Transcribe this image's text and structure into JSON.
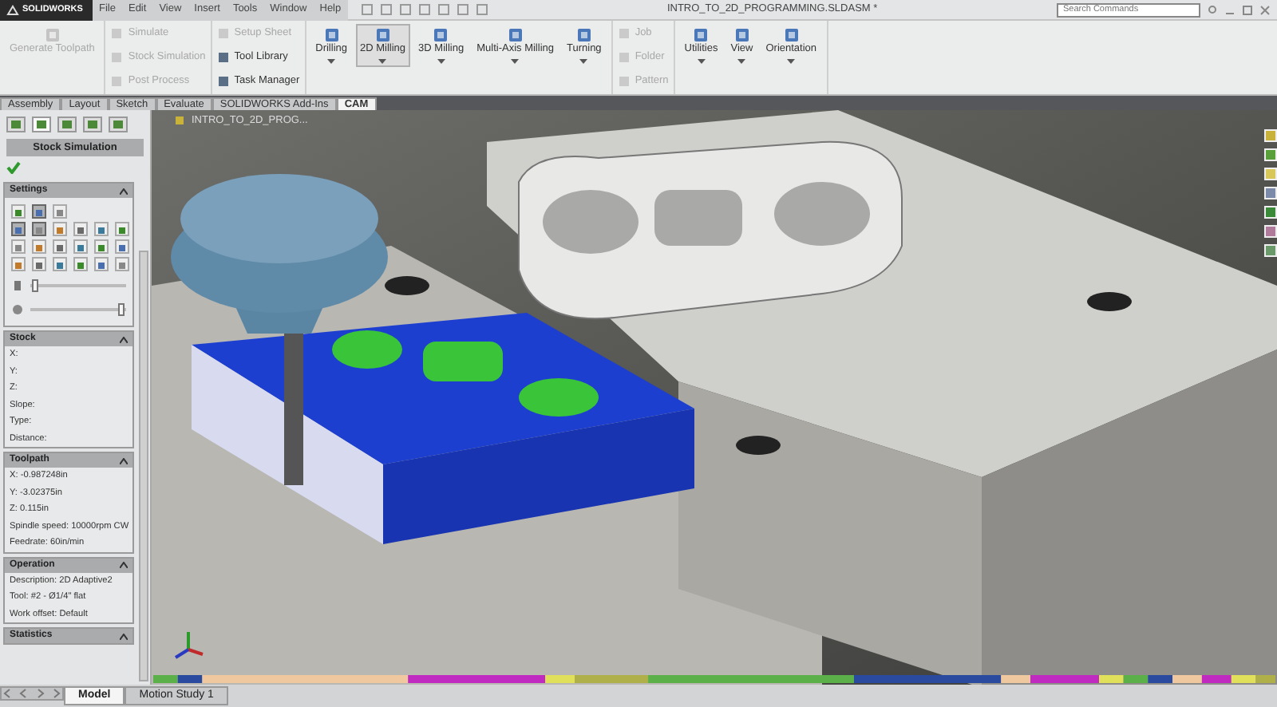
{
  "app": {
    "logo": "SOLIDWORKS",
    "menu": [
      "File",
      "Edit",
      "View",
      "Insert",
      "Tools",
      "Window",
      "Help"
    ],
    "title": "INTRO_TO_2D_PROGRAMMING.SLDASM *",
    "search": {
      "placeholder": "Search Commands"
    }
  },
  "ribbon": [
    {
      "kind": "large",
      "items": [
        {
          "label": "Generate Toolpath",
          "disabled": true,
          "selected": false
        }
      ]
    },
    {
      "kind": "small",
      "items": [
        {
          "label": "Simulate",
          "disabled": true
        },
        {
          "label": "Stock Simulation",
          "disabled": true
        },
        {
          "label": "Post Process",
          "disabled": true
        }
      ]
    },
    {
      "kind": "small",
      "items": [
        {
          "label": "Setup Sheet",
          "disabled": true
        },
        {
          "label": "Tool Library",
          "disabled": false
        },
        {
          "label": "Task Manager",
          "disabled": false
        }
      ]
    },
    {
      "kind": "large",
      "items": [
        {
          "label": "Drilling",
          "disabled": false,
          "selected": false
        },
        {
          "label": "2D Milling",
          "disabled": false,
          "selected": true
        },
        {
          "label": "3D Milling",
          "disabled": false,
          "selected": false
        },
        {
          "label": "Multi-Axis Milling",
          "disabled": false,
          "selected": false
        },
        {
          "label": "Turning",
          "disabled": false,
          "selected": false
        }
      ]
    },
    {
      "kind": "small",
      "items": [
        {
          "label": "Job",
          "disabled": true
        },
        {
          "label": "Folder",
          "disabled": true
        },
        {
          "label": "Pattern",
          "disabled": true
        }
      ]
    },
    {
      "kind": "large",
      "items": [
        {
          "label": "Utilities",
          "disabled": false,
          "selected": false
        },
        {
          "label": "View",
          "disabled": false,
          "selected": false
        },
        {
          "label": "Orientation",
          "disabled": false,
          "selected": false
        }
      ]
    }
  ],
  "tabs": [
    {
      "label": "Assembly",
      "selected": false
    },
    {
      "label": "Layout",
      "selected": false
    },
    {
      "label": "Sketch",
      "selected": false
    },
    {
      "label": "Evaluate",
      "selected": false
    },
    {
      "label": "SOLIDWORKS Add-Ins",
      "selected": false
    },
    {
      "label": "CAM",
      "selected": true
    }
  ],
  "panel": {
    "tabs": [
      {
        "selected": false
      },
      {
        "selected": true
      },
      {
        "selected": false
      },
      {
        "selected": false
      },
      {
        "selected": false
      }
    ],
    "title": "Stock Simulation",
    "settings": {
      "title": "Settings",
      "tool_rows": [
        [
          {
            "pressed": false
          },
          {
            "pressed": true
          },
          {
            "pressed": false
          }
        ],
        [
          {
            "pressed": true
          },
          {
            "pressed": true
          },
          {
            "pressed": false
          },
          {
            "pressed": false
          },
          {
            "pressed": false
          },
          {
            "pressed": false
          }
        ],
        [
          {
            "pressed": false
          },
          {
            "pressed": false
          },
          {
            "pressed": false
          },
          {
            "pressed": false
          },
          {
            "pressed": false
          },
          {
            "pressed": false
          }
        ],
        [
          {
            "pressed": false
          },
          {
            "pressed": false
          },
          {
            "pressed": false
          },
          {
            "pressed": false
          },
          {
            "pressed": false
          },
          {
            "pressed": false
          }
        ]
      ],
      "sliders": [
        {
          "level": 0.05
        },
        {
          "level": 0.95
        }
      ]
    },
    "sections": [
      {
        "title": "Stock",
        "lines": [
          "X:",
          "Y:",
          "Z:",
          "Slope:",
          "Type:",
          "Distance:"
        ]
      },
      {
        "title": "Toolpath",
        "lines": [
          "X: -0.987248in",
          "Y: -3.02375in",
          "Z: 0.115in",
          "Spindle speed: 10000rpm CW",
          "Feedrate: 60in/min"
        ]
      },
      {
        "title": "Operation",
        "lines": [
          "Description: 2D Adaptive2",
          "Tool: #2 - Ø1/4\" flat",
          "Work offset: Default"
        ]
      },
      {
        "title": "Statistics"
      }
    ]
  },
  "viewport": {
    "tree_label": "INTRO_TO_2D_PROG..."
  },
  "bottom_tabs": [
    {
      "label": "Model",
      "selected": true
    },
    {
      "label": "Motion Study 1",
      "selected": false
    }
  ]
}
